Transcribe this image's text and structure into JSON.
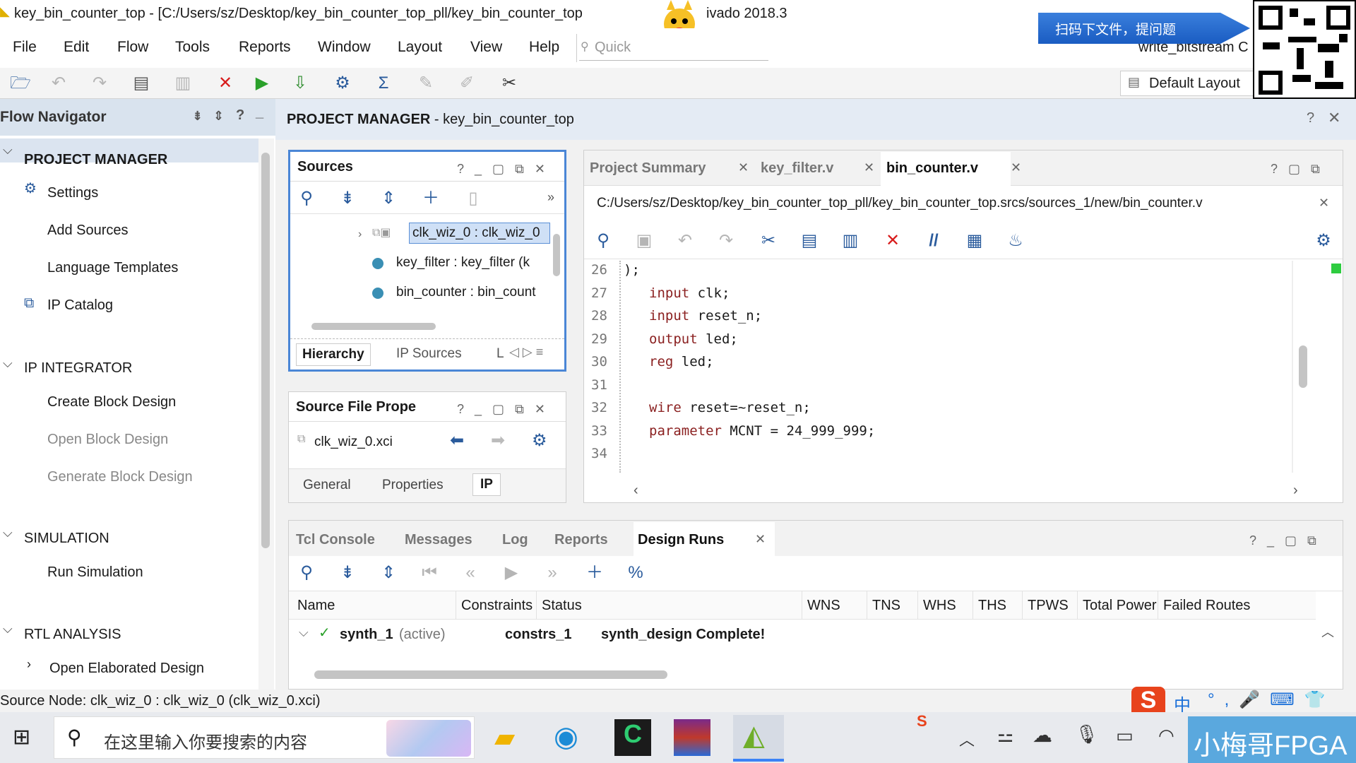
{
  "window": {
    "title": "key_bin_counter_top - [C:/Users/sz/Desktop/key_bin_counter_top_pll/key_bin_counter_top",
    "title_tail": "ivado 2018.3"
  },
  "menu": [
    "File",
    "Edit",
    "Flow",
    "Tools",
    "Reports",
    "Window",
    "Layout",
    "View",
    "Help"
  ],
  "quick_search": {
    "placeholder": "Quick"
  },
  "right_toolbar": {
    "run_status": "write_bitstream C",
    "layout_label": "Default Layout"
  },
  "banner_text": "扫码下文件，提问题",
  "flow_nav": {
    "title": "Flow Navigator",
    "sections": [
      {
        "label": "PROJECT MANAGER",
        "items": [
          "Settings",
          "Add Sources",
          "Language Templates",
          "IP Catalog"
        ]
      },
      {
        "label": "IP INTEGRATOR",
        "items": [
          "Create Block Design",
          "Open Block Design",
          "Generate Block Design"
        ]
      },
      {
        "label": "SIMULATION",
        "items": [
          "Run Simulation"
        ]
      },
      {
        "label": "RTL ANALYSIS",
        "items": [
          "Open Elaborated Design"
        ]
      }
    ]
  },
  "project_manager": {
    "label": "PROJECT MANAGER",
    "project": "- key_bin_counter_top"
  },
  "sources": {
    "title": "Sources",
    "tree": [
      "clk_wiz_0 : clk_wiz_0",
      "key_filter : key_filter (k",
      "bin_counter : bin_count"
    ],
    "tabs": [
      "Hierarchy",
      "IP Sources",
      "L"
    ]
  },
  "file_props": {
    "title": "Source File Prope",
    "file": "clk_wiz_0.xci",
    "tabs": [
      "General",
      "Properties",
      "IP"
    ]
  },
  "editor": {
    "tabs": [
      "Project Summary",
      "key_filter.v",
      "bin_counter.v"
    ],
    "path": "C:/Users/sz/Desktop/key_bin_counter_top_pll/key_bin_counter_top.srcs/sources_1/new/bin_counter.v",
    "lines": [
      {
        "n": "26",
        "kw": "",
        "text": ");"
      },
      {
        "n": "27",
        "kw": "input",
        "text": " clk;"
      },
      {
        "n": "28",
        "kw": "input",
        "text": " reset_n;"
      },
      {
        "n": "29",
        "kw": "output",
        "text": " led;"
      },
      {
        "n": "30",
        "kw": "reg",
        "text": " led;"
      },
      {
        "n": "31",
        "kw": "",
        "text": ""
      },
      {
        "n": "32",
        "kw": "wire",
        "text": " reset=~reset_n;"
      },
      {
        "n": "33",
        "kw": "parameter",
        "text": " MCNT = 24_999_999;"
      },
      {
        "n": "34",
        "kw": "",
        "text": ""
      }
    ]
  },
  "bottom": {
    "tabs": [
      "Tcl Console",
      "Messages",
      "Log",
      "Reports",
      "Design Runs"
    ],
    "columns": [
      "Name",
      "Constraints",
      "Status",
      "WNS",
      "TNS",
      "WHS",
      "THS",
      "TPWS",
      "Total Power",
      "Failed Routes"
    ],
    "row": {
      "name": "synth_1",
      "active": "(active)",
      "constraints": "constrs_1",
      "status": "synth_design Complete!"
    }
  },
  "status_bar": "Source Node: clk_wiz_0 : clk_wiz_0 (clk_wiz_0.xci)",
  "taskbar": {
    "search_placeholder": "在这里输入你要搜索的内容",
    "ime": "中",
    "watermark": "小梅哥FPGA"
  }
}
